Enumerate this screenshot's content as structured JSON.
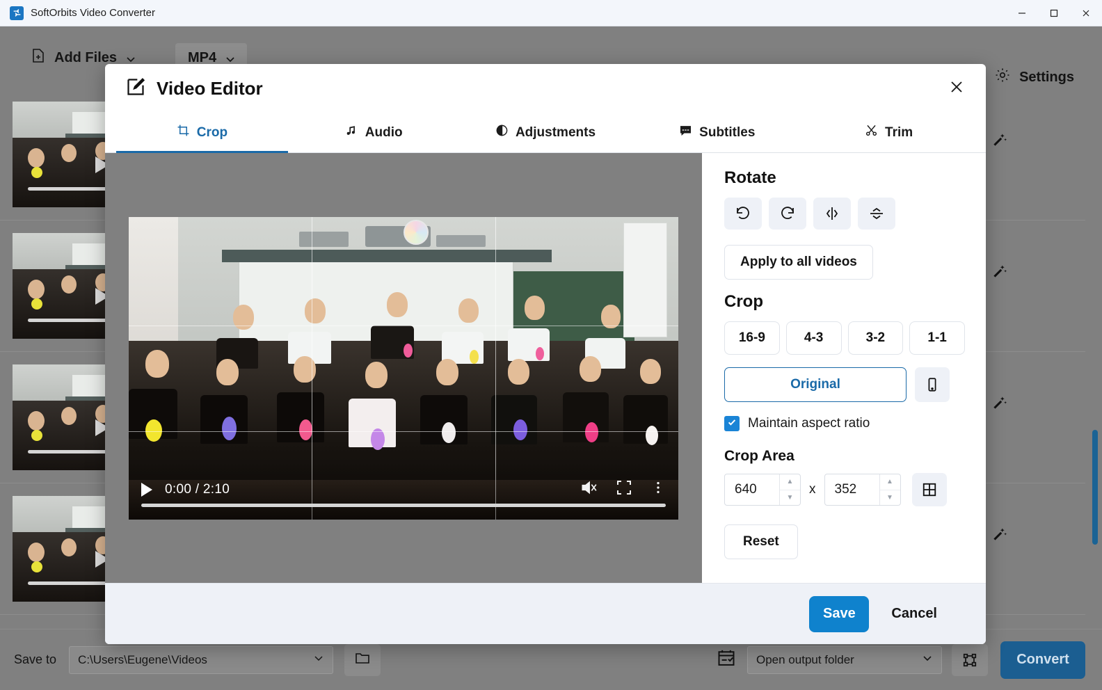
{
  "window": {
    "title": "SoftOrbits Video Converter",
    "app_icon": "app-logo-icon",
    "minimize": "minimize-icon",
    "maximize": "maximize-icon",
    "close": "close-icon"
  },
  "toolbar": {
    "add_files_label": "Add Files",
    "add_files_icon": "add-file-icon",
    "format_label": "MP4",
    "convert_all_icon": "refresh-icon",
    "select_all_icon": "checkbox-icon",
    "settings_label": "Settings",
    "settings_icon": "gear-icon"
  },
  "file_list": {
    "rows": [
      {
        "expand_icon": "chevron-down-icon",
        "edit_icon": "magic-wand-icon"
      },
      {
        "expand_icon": "chevron-down-icon",
        "edit_icon": "magic-wand-icon"
      },
      {
        "expand_icon": "chevron-down-icon",
        "edit_icon": "magic-wand-icon"
      },
      {
        "expand_icon": "chevron-down-icon",
        "edit_icon": "magic-wand-icon"
      }
    ]
  },
  "bottom_bar": {
    "save_to_label": "Save to",
    "save_to_path": "C:\\Users\\Eugene\\Videos",
    "path_dropdown_icon": "chevron-down-icon",
    "browse_icon": "folder-icon",
    "schedule_icon": "calendar-check-icon",
    "after_convert_action": "Open output folder",
    "after_convert_dropdown_icon": "chevron-down-icon",
    "merge_icon": "merge-grid-icon",
    "convert_label": "Convert"
  },
  "dialog": {
    "title": "Video Editor",
    "title_icon": "edit-square-icon",
    "close_icon": "close-icon",
    "tabs": [
      {
        "label": "Crop",
        "icon": "crop-icon",
        "active": true
      },
      {
        "label": "Audio",
        "icon": "music-note-icon",
        "active": false
      },
      {
        "label": "Adjustments",
        "icon": "contrast-circle-icon",
        "active": false
      },
      {
        "label": "Subtitles",
        "icon": "subtitle-bubble-icon",
        "active": false
      },
      {
        "label": "Trim",
        "icon": "scissors-icon",
        "active": false
      }
    ],
    "player": {
      "play_icon": "play-icon",
      "time": "0:00 / 2:10",
      "mute_icon": "volume-muted-icon",
      "fullscreen_icon": "fullscreen-icon",
      "more_icon": "more-vertical-icon"
    },
    "panel": {
      "rotate_title": "Rotate",
      "rotate_buttons": [
        {
          "name": "rotate-left-icon"
        },
        {
          "name": "rotate-right-icon"
        },
        {
          "name": "flip-horizontal-icon"
        },
        {
          "name": "flip-vertical-icon"
        }
      ],
      "apply_all_label": "Apply to all videos",
      "crop_title": "Crop",
      "ratios": [
        "16-9",
        "4-3",
        "3-2",
        "1-1"
      ],
      "original_label": "Original",
      "portrait_icon": "smartphone-icon",
      "maintain_aspect_label": "Maintain aspect ratio",
      "maintain_aspect_checked": true,
      "check_icon": "check-icon",
      "crop_area_title": "Crop Area",
      "crop_width": "640",
      "crop_height": "352",
      "crop_separator": "x",
      "crop_grid_icon": "grid-four-icon",
      "reset_label": "Reset"
    },
    "footer": {
      "save_label": "Save",
      "cancel_label": "Cancel"
    }
  },
  "colors": {
    "accent_blue": "#1a6aa8",
    "save_blue": "#0f82cd",
    "convert_blue": "#1b5e91",
    "checkbox_blue": "#1a84d6",
    "app_background": "#808080",
    "dialog_background": "#ffffff",
    "footer_background": "#eef1f7"
  }
}
